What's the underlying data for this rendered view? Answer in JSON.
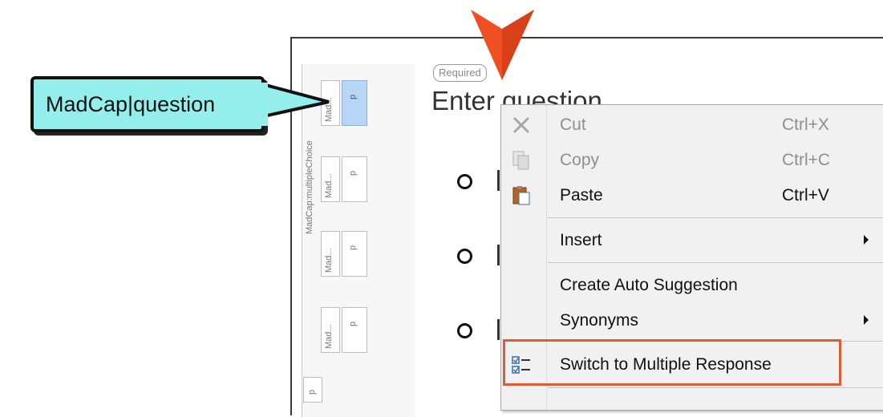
{
  "callout": {
    "text": "MadCap|question"
  },
  "structure": {
    "outer_label": "MadCap:multipleChoice",
    "cells": [
      {
        "label": "Mad...",
        "tag": "p"
      },
      {
        "label": "Mad...",
        "tag": "p"
      },
      {
        "label": "Mad...",
        "tag": "p"
      },
      {
        "label": "Mad...",
        "tag": "p"
      }
    ],
    "bottom_tag": "p"
  },
  "question": {
    "required_badge": "Required",
    "placeholder": "Enter question"
  },
  "context_menu": {
    "items": [
      {
        "label": "Cut",
        "shortcut": "Ctrl+X",
        "enabled": false,
        "icon": "scissors-icon"
      },
      {
        "label": "Copy",
        "shortcut": "Ctrl+C",
        "enabled": false,
        "icon": "copy-icon"
      },
      {
        "label": "Paste",
        "shortcut": "Ctrl+V",
        "enabled": true,
        "icon": "paste-icon"
      },
      {
        "label": "Insert",
        "shortcut": "",
        "enabled": true,
        "submenu": true
      },
      {
        "label": "Create Auto Suggestion",
        "shortcut": "",
        "enabled": true
      },
      {
        "label": "Synonyms",
        "shortcut": "",
        "enabled": true,
        "submenu": true
      },
      {
        "label": "Switch to Multiple Response",
        "shortcut": "",
        "enabled": true,
        "icon": "multiple-response-icon",
        "highlighted": true
      }
    ]
  },
  "colors": {
    "callout_fill": "#94efec",
    "arrow": "#f04e23",
    "highlight_border": "#e05a36",
    "selected_cell": "#b7d6f5"
  }
}
